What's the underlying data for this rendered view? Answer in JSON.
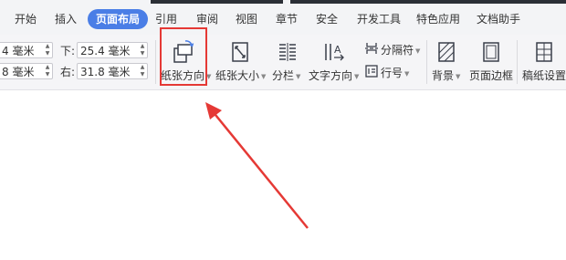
{
  "tabs": [
    {
      "label": "开始",
      "active": false
    },
    {
      "label": "插入",
      "active": false
    },
    {
      "label": "页面布局",
      "active": true
    },
    {
      "label": "引用",
      "active": false
    },
    {
      "label": "审阅",
      "active": false
    },
    {
      "label": "视图",
      "active": false
    },
    {
      "label": "章节",
      "active": false
    },
    {
      "label": "安全",
      "active": false
    },
    {
      "label": "开发工具",
      "active": false
    },
    {
      "label": "特色应用",
      "active": false
    },
    {
      "label": "文档助手",
      "active": false
    }
  ],
  "margins": {
    "top_left_value": "4 毫米",
    "bottom_left_value": "8 毫米",
    "down_label": "下:",
    "down_value": "25.4 毫米",
    "right_label": "右:",
    "right_value": "31.8 毫米"
  },
  "tools": {
    "orientation": "纸张方向",
    "size": "纸张大小",
    "columns": "分栏",
    "text_direction": "文字方向",
    "separator": "分隔符",
    "line_number": "行号",
    "background": "背景",
    "page_border": "页面边框",
    "manuscript": "稿纸设置"
  },
  "colors": {
    "accent": "#4a7ee6",
    "highlight": "#e53935",
    "icon": "#3a3f4a"
  }
}
